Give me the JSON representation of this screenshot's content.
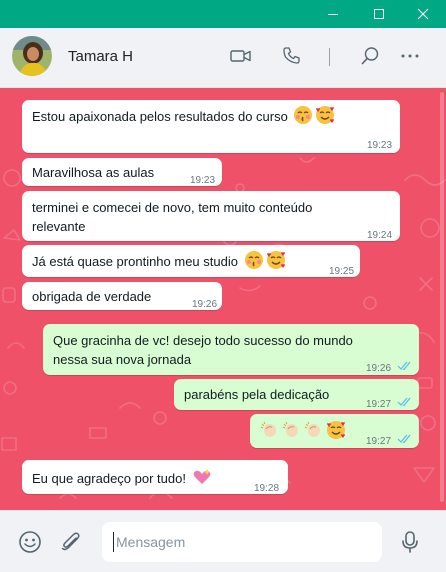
{
  "window": {
    "controls": {
      "minimize_icon": "minimize-icon",
      "maximize_icon": "maximize-icon",
      "close_icon": "close-icon"
    },
    "accent": "#00a884"
  },
  "header": {
    "contact_name": "Tamara H",
    "icons": [
      "video-call-icon",
      "voice-call-icon",
      "search-icon",
      "more-options-icon"
    ]
  },
  "chat": {
    "background_color": "#ef5169",
    "incoming_bubble_color": "#ffffff",
    "outgoing_bubble_color": "#d9fdd3",
    "messages": [
      {
        "direction": "incoming",
        "text": "Estou apaixonada pelos resultados do curso",
        "emojis": [
          "kissing-face",
          "smiling-face-with-hearts"
        ],
        "time": "19:23"
      },
      {
        "direction": "incoming",
        "text": "Maravilhosa as aulas",
        "time": "19:23"
      },
      {
        "direction": "incoming",
        "text_lines": [
          "terminei e comecei de novo, tem muito conteúdo",
          "relevante"
        ],
        "time": "19:24"
      },
      {
        "direction": "incoming",
        "text": "Já está quase prontinho meu studio",
        "emojis": [
          "kissing-face",
          "smiling-face-with-hearts"
        ],
        "time": "19:25"
      },
      {
        "direction": "incoming",
        "text": "obrigada de verdade",
        "time": "19:26"
      },
      {
        "direction": "outgoing",
        "text_lines": [
          "Que gracinha de vc! desejo todo sucesso do mundo",
          "nessa sua nova jornada"
        ],
        "time": "19:26",
        "status": "read"
      },
      {
        "direction": "outgoing",
        "text": "parabéns pela dedicação",
        "time": "19:27",
        "status": "read"
      },
      {
        "direction": "outgoing",
        "emojis": [
          "clapping-hands",
          "clapping-hands",
          "clapping-hands",
          "smiling-face-with-hearts"
        ],
        "time": "19:27",
        "status": "read"
      },
      {
        "direction": "incoming",
        "text": "Eu que agradeço por tudo!",
        "emojis": [
          "sparkling-heart"
        ],
        "time": "19:28"
      }
    ]
  },
  "composer": {
    "placeholder": "Mensagem",
    "icons": [
      "emoji-icon",
      "attach-icon",
      "microphone-icon"
    ]
  }
}
